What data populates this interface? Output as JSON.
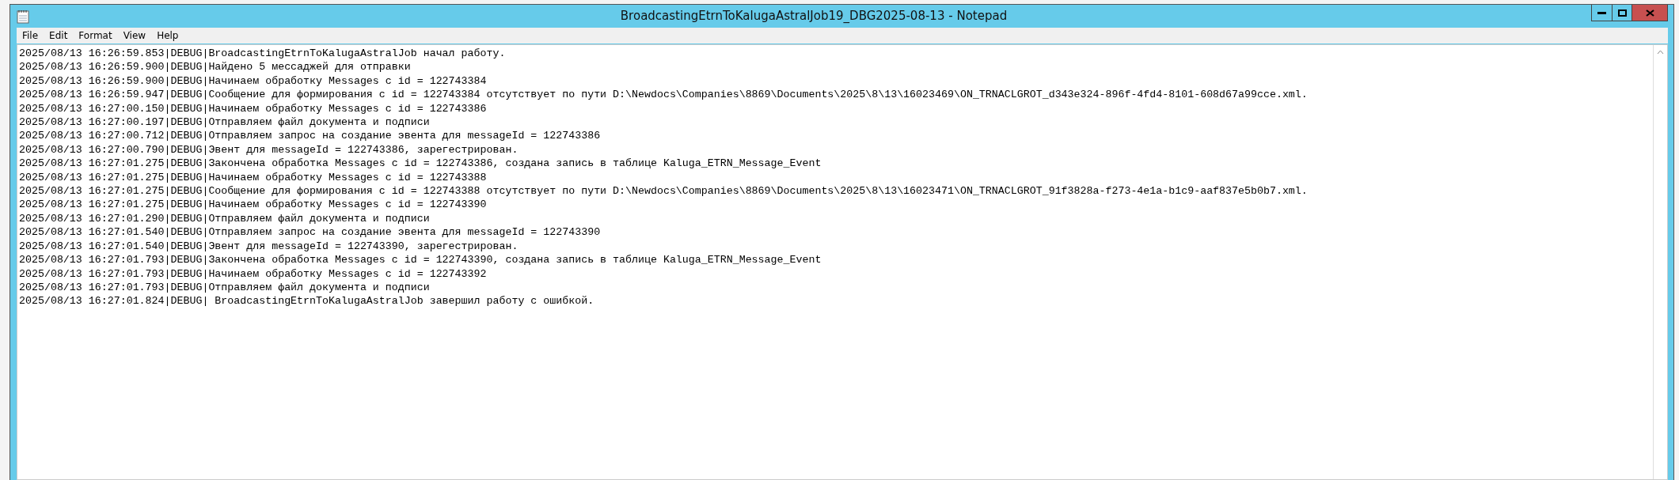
{
  "window": {
    "title": "BroadcastingEtrnToKalugaAstralJob19_DBG2025-08-13 - Notepad"
  },
  "menu": [
    "File",
    "Edit",
    "Format",
    "View",
    "Help"
  ],
  "lines": [
    "2025/08/13 16:26:59.853|DEBUG|BroadcastingEtrnToKalugaAstralJob начал работу.",
    "2025/08/13 16:26:59.900|DEBUG|Найдено 5 мессаджей для отправки",
    "2025/08/13 16:26:59.900|DEBUG|Начинаем обработку Messages с id = 122743384",
    "2025/08/13 16:26:59.947|DEBUG|Сообщение для формирования с id = 122743384 отсутствует по пути D:\\Newdocs\\Companies\\8869\\Documents\\2025\\8\\13\\16023469\\ON_TRNACLGROT_d343e324-896f-4fd4-8101-608d67a99cce.xml.",
    "2025/08/13 16:27:00.150|DEBUG|Начинаем обработку Messages с id = 122743386",
    "2025/08/13 16:27:00.197|DEBUG|Отправляем файл документа и подписи",
    "2025/08/13 16:27:00.712|DEBUG|Отправляем запрос на создание эвента для messageId = 122743386",
    "2025/08/13 16:27:00.790|DEBUG|Эвент для messageId = 122743386, зарегестрирован.",
    "2025/08/13 16:27:01.275|DEBUG|Закончена обработка Messages с id = 122743386, создана запись в таблице Kaluga_ETRN_Message_Event",
    "2025/08/13 16:27:01.275|DEBUG|Начинаем обработку Messages с id = 122743388",
    "2025/08/13 16:27:01.275|DEBUG|Сообщение для формирования с id = 122743388 отсутствует по пути D:\\Newdocs\\Companies\\8869\\Documents\\2025\\8\\13\\16023471\\ON_TRNACLGROT_91f3828a-f273-4e1a-b1c9-aaf837e5b0b7.xml.",
    "2025/08/13 16:27:01.275|DEBUG|Начинаем обработку Messages с id = 122743390",
    "2025/08/13 16:27:01.290|DEBUG|Отправляем файл документа и подписи",
    "2025/08/13 16:27:01.540|DEBUG|Отправляем запрос на создание эвента для messageId = 122743390",
    "2025/08/13 16:27:01.540|DEBUG|Эвент для messageId = 122743390, зарегестрирован.",
    "2025/08/13 16:27:01.793|DEBUG|Закончена обработка Messages с id = 122743390, создана запись в таблице Kaluga_ETRN_Message_Event",
    "2025/08/13 16:27:01.793|DEBUG|Начинаем обработку Messages с id = 122743392",
    "2025/08/13 16:27:01.793|DEBUG|Отправляем файл документа и подписи",
    "2025/08/13 16:27:01.824|DEBUG| BroadcastingEtrnToKalugaAstralJob завершил работу с ошибкой."
  ]
}
